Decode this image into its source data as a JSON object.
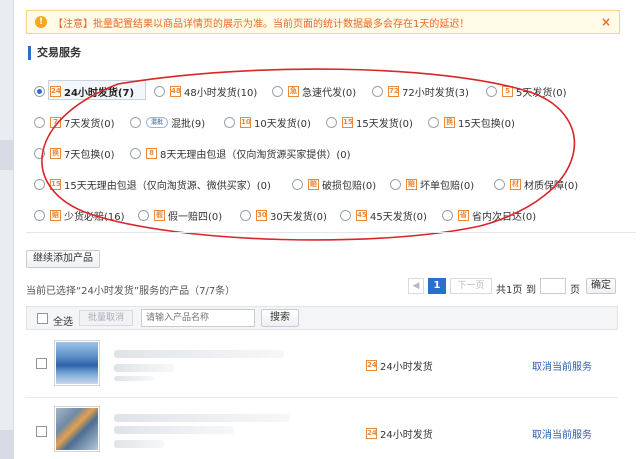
{
  "notice": {
    "text": "【注意】批量配置结果以商品详情页的展示为准。当前页面的统计数据最多会存在1天的延迟！",
    "close_label": "×"
  },
  "section_title": "交易服务",
  "service_options": [
    {
      "label": "24小时发货(7)",
      "selected": true,
      "icon": "24"
    },
    {
      "label": "48小时发货(10)",
      "selected": false,
      "icon": "48"
    },
    {
      "label": "急速代发(0)",
      "selected": false,
      "icon": "急"
    },
    {
      "label": "72小时发货(3)",
      "selected": false,
      "icon": "72"
    },
    {
      "label": "5天发货(0)",
      "selected": false,
      "icon": "5"
    },
    {
      "label": "7天发货(0)",
      "selected": false,
      "icon": "7"
    },
    {
      "label": "混批(9)",
      "selected": false,
      "icon": "混批"
    },
    {
      "label": "10天发货(0)",
      "selected": false,
      "icon": "10"
    },
    {
      "label": "15天发货(0)",
      "selected": false,
      "icon": "15"
    },
    {
      "label": "15天包换(0)",
      "selected": false,
      "icon": "换"
    },
    {
      "label": "7天包换(0)",
      "selected": false,
      "icon": "换"
    },
    {
      "label": "8天无理由包退（仅向淘货源买家提供）(0)",
      "selected": false,
      "icon": "8"
    },
    {
      "label": "15天无理由包退（仅向淘货源、微供买家）(0)",
      "selected": false,
      "icon": "15"
    },
    {
      "label": "破损包赔(0)",
      "selected": false,
      "icon": "赔"
    },
    {
      "label": "坏单包赔(0)",
      "selected": false,
      "icon": "赔"
    },
    {
      "label": "材质保障(0)",
      "selected": false,
      "icon": "材"
    },
    {
      "label": "少货必赔(16)",
      "selected": false,
      "icon": "赔"
    },
    {
      "label": "假一赔四(0)",
      "selected": false,
      "icon": "假"
    },
    {
      "label": "30天发货(0)",
      "selected": false,
      "icon": "30"
    },
    {
      "label": "45天发货(0)",
      "selected": false,
      "icon": "45"
    },
    {
      "label": "省内次日达(0)",
      "selected": false,
      "icon": "省"
    }
  ],
  "add_product_button": "继续添加产品",
  "status_text": "当前已选择“24小时发货”服务的产品（7/7条）",
  "pager": {
    "prev": "上一页",
    "current": "1",
    "next": "下一页",
    "total": "共1页",
    "goto": "到",
    "page_unit": "页",
    "confirm": "确定"
  },
  "table_toolbar": {
    "select_all": "全选",
    "batch_cancel": "批量取消",
    "search_placeholder": "请输入产品名称",
    "search_button": "搜索"
  },
  "products": [
    {
      "service": "24小时发货",
      "action": "取消当前服务"
    },
    {
      "service": "24小时发货",
      "action": "取消当前服务"
    }
  ],
  "colors": {
    "accent": "#2a6ecf",
    "notice_text": "#e86a2c",
    "annotation_red": "#d9262a",
    "link": "#2a5db0"
  }
}
